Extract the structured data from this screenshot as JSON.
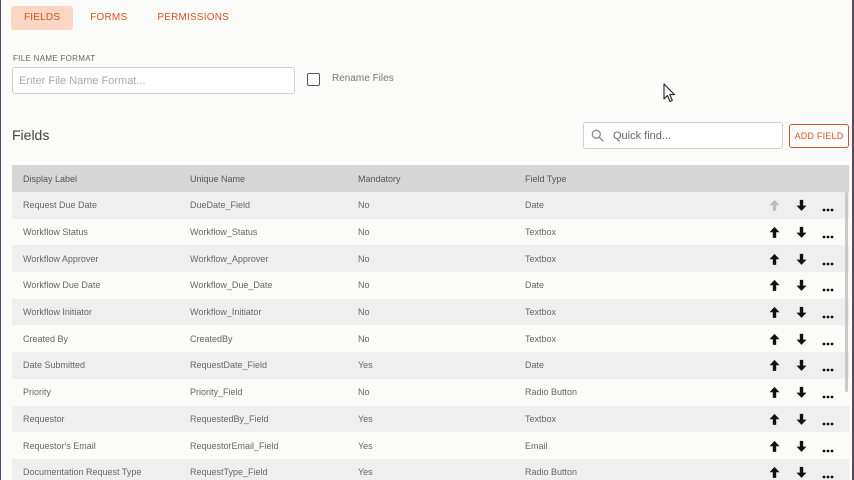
{
  "tabs": [
    {
      "label": "FIELDS",
      "active": true
    },
    {
      "label": "FORMS",
      "active": false
    },
    {
      "label": "PERMISSIONS",
      "active": false
    }
  ],
  "file_name_format": {
    "label": "FILE NAME FORMAT",
    "placeholder": "Enter File Name Format...",
    "value": ""
  },
  "rename_files": {
    "label": "Rename Files",
    "checked": false
  },
  "fields_section": {
    "title": "Fields",
    "search_placeholder": "Quick find...",
    "add_button": "ADD FIELD"
  },
  "table": {
    "headers": [
      "Display Label",
      "Unique Name",
      "Mandatory",
      "Field Type"
    ],
    "rows": [
      {
        "label": "Request Due Date",
        "unique": "DueDate_Field",
        "mandatory": "No",
        "type": "Date",
        "up_enabled": false
      },
      {
        "label": "Workflow Status",
        "unique": "Workflow_Status",
        "mandatory": "No",
        "type": "Textbox",
        "up_enabled": true
      },
      {
        "label": "Workflow Approver",
        "unique": "Workflow_Approver",
        "mandatory": "No",
        "type": "Textbox",
        "up_enabled": true
      },
      {
        "label": "Workflow Due Date",
        "unique": "Workflow_Due_Date",
        "mandatory": "No",
        "type": "Date",
        "up_enabled": true
      },
      {
        "label": "Workflow Initiator",
        "unique": "Workflow_Initiator",
        "mandatory": "No",
        "type": "Textbox",
        "up_enabled": true
      },
      {
        "label": "Created By",
        "unique": "CreatedBy",
        "mandatory": "No",
        "type": "Textbox",
        "up_enabled": true
      },
      {
        "label": "Date Submitted",
        "unique": "RequestDate_Field",
        "mandatory": "Yes",
        "type": "Date",
        "up_enabled": true
      },
      {
        "label": "Priority",
        "unique": "Priority_Field",
        "mandatory": "No",
        "type": "Radio Button",
        "up_enabled": true
      },
      {
        "label": "Requestor",
        "unique": "RequestedBy_Field",
        "mandatory": "Yes",
        "type": "Textbox",
        "up_enabled": true
      },
      {
        "label": "Requestor's Email",
        "unique": "RequestorEmail_Field",
        "mandatory": "Yes",
        "type": "Email",
        "up_enabled": true
      },
      {
        "label": "Documentation Request Type",
        "unique": "RequestType_Field",
        "mandatory": "Yes",
        "type": "Radio Button",
        "up_enabled": true
      }
    ]
  },
  "colors": {
    "accent": "#d8521e",
    "active_tab_bg": "#fbd6c3",
    "header_bg": "#d6d6d6",
    "row_alt_bg": "#efefef",
    "disabled_arrow": "#bdbdbd"
  },
  "icons": {
    "search": "search-icon",
    "up": "arrow-up-icon",
    "down": "arrow-down-icon",
    "more": "more-horizontal-icon",
    "cursor": "mouse-pointer-icon"
  }
}
